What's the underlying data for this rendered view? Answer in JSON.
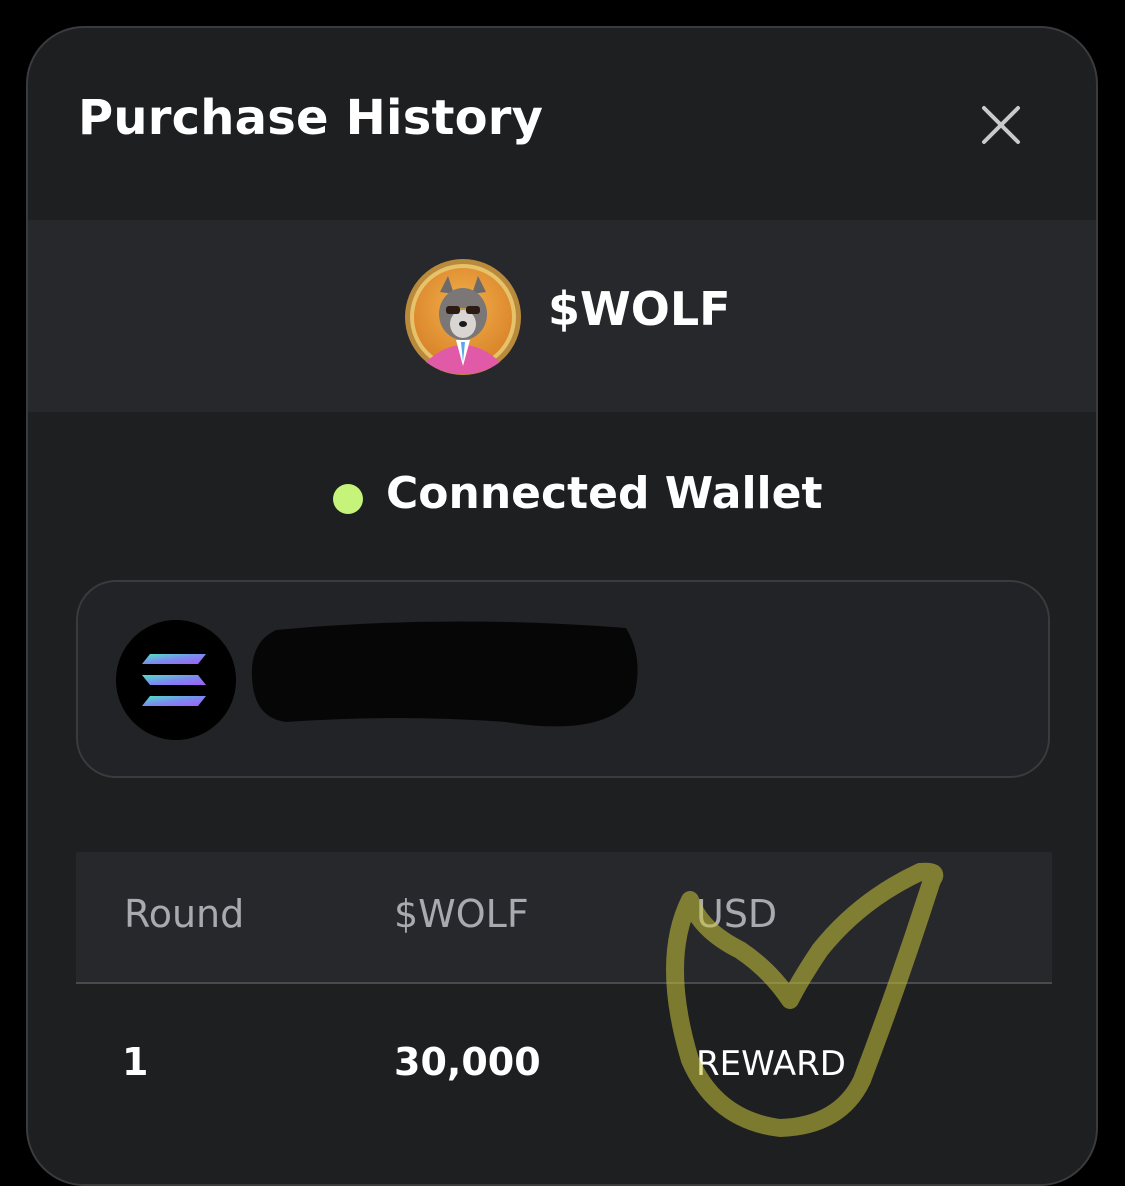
{
  "header": {
    "title": "Purchase History",
    "close_icon": "close-icon"
  },
  "token": {
    "name": "$WOLF",
    "avatar_icon": "wolf-avatar-icon"
  },
  "wallet_status": {
    "label": "Connected Wallet",
    "dot_color": "#c6f47a"
  },
  "wallet": {
    "chain_icon": "solana-icon",
    "address": ""
  },
  "table": {
    "headers": [
      "Round",
      "$WOLF",
      "USD"
    ],
    "rows": [
      {
        "round": "1",
        "amount": "30,000",
        "usd": "REWARD"
      }
    ]
  },
  "colors": {
    "background": "#000000",
    "modal": "#1e1f21",
    "band": "#27282b",
    "accent_dot": "#c6f47a",
    "annotation": "#c9c53a"
  }
}
